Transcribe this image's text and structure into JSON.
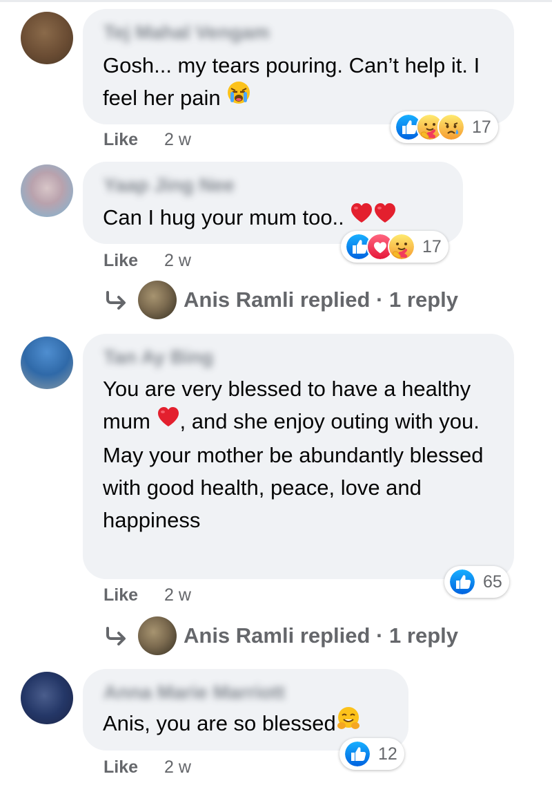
{
  "comments": [
    {
      "author": "Tej Mahal Vengam",
      "text": "Gosh... my tears pouring. Can’t help it. I feel her pain",
      "reaction_count": "17",
      "like_label": "Like",
      "time": "2 w"
    },
    {
      "author": "Yaap Jing Nee",
      "text": "Can I hug your mum too..",
      "reaction_count": "17",
      "like_label": "Like",
      "time": "2 w",
      "reply": {
        "name": "Anis Ramli replied",
        "sep": " · ",
        "count": "1 reply"
      }
    },
    {
      "author": "Tan Ay Bing",
      "text_line1a": "You are very blessed to have a healthy mum",
      "text_line1b": ", and she enjoy outing with you.",
      "text_line2": "May your mother be abundantly blessed with good health, peace, love and happiness",
      "reaction_count": "65",
      "like_label": "Like",
      "time": "2 w",
      "reply": {
        "name": "Anis Ramli replied",
        "sep": " · ",
        "count": "1 reply"
      }
    },
    {
      "author": "Anna Marie Marriott",
      "text": "Anis, you are so blessed",
      "reaction_count": "12",
      "like_label": "Like",
      "time": "2 w"
    }
  ],
  "colors": {
    "like_blue": "#1877f2",
    "love_red": "#f33e58",
    "care_yellow": "#f7b928",
    "bubble_bg": "#f0f2f5",
    "meta_gray": "#65676b"
  },
  "icons": [
    "like-icon",
    "love-icon",
    "care-icon",
    "sad-icon",
    "crying-face-icon",
    "red-heart-icon",
    "hugging-face-icon",
    "reply-arrow-icon"
  ]
}
